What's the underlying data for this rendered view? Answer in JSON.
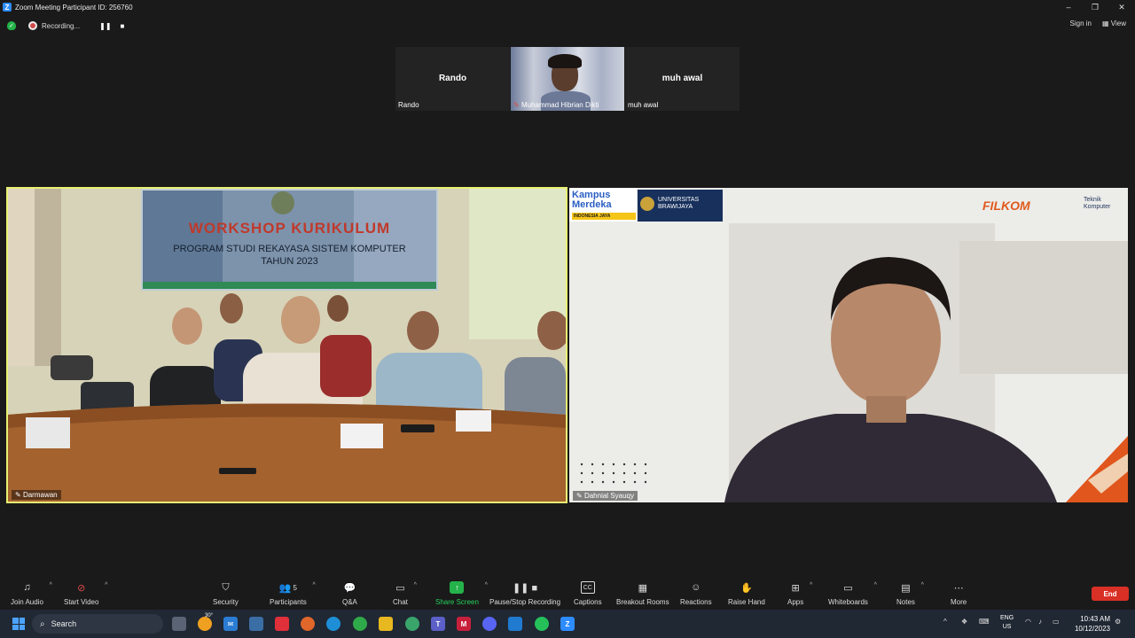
{
  "window": {
    "title": "Zoom Meeting Participant ID: 256760",
    "minimize": "–",
    "restore": "❐",
    "close": "✕"
  },
  "recording": {
    "status": "Recording...",
    "pause": "❚❚",
    "stop": "■"
  },
  "top_right": {
    "sign_in": "Sign in",
    "view": "View"
  },
  "strip": [
    {
      "center_name": "Rando",
      "label": "Rando"
    },
    {
      "label": "Muhammad Hibrian Dikti"
    },
    {
      "center_name": "muh awal",
      "label": "muh awal"
    }
  ],
  "left_video": {
    "label": "Darmawan",
    "banner_line1": "WORKSHOP KURIKULUM",
    "banner_line2": "PROGRAM STUDI REKAYASA SISTEM KOMPUTER",
    "banner_line3": "TAHUN 2023"
  },
  "right_video": {
    "label": "Dahnial Syauqy",
    "logo_kampus": "Kampus Merdeka",
    "logo_kampus_sub": "INDONESIA JAYA",
    "logo_ub": "UNIVERSITAS BRAWIJAYA",
    "logo_filkom": "FILKOM",
    "logo_tk": "Teknik Komputer"
  },
  "toolbar": {
    "join_audio": "Join Audio",
    "start_video": "Start Video",
    "security": "Security",
    "participants": "Participants",
    "participants_count": "5",
    "qa": "Q&A",
    "chat": "Chat",
    "share_screen": "Share Screen",
    "pause_stop": "Pause/Stop Recording",
    "captions": "Captions",
    "breakout": "Breakout Rooms",
    "reactions": "Reactions",
    "raise_hand": "Raise Hand",
    "apps": "Apps",
    "whiteboards": "Whiteboards",
    "notes": "Notes",
    "more": "More",
    "end": "End"
  },
  "taskbar": {
    "search": "Search",
    "weather": "30°",
    "lang1": "ENG",
    "lang2": "US",
    "time": "10:43 AM",
    "date": "10/12/2023"
  },
  "colors": {
    "active_border": "#e8f074",
    "share_green": "#24b24a",
    "end_red": "#d93026",
    "zoom_blue": "#2d8cff"
  }
}
